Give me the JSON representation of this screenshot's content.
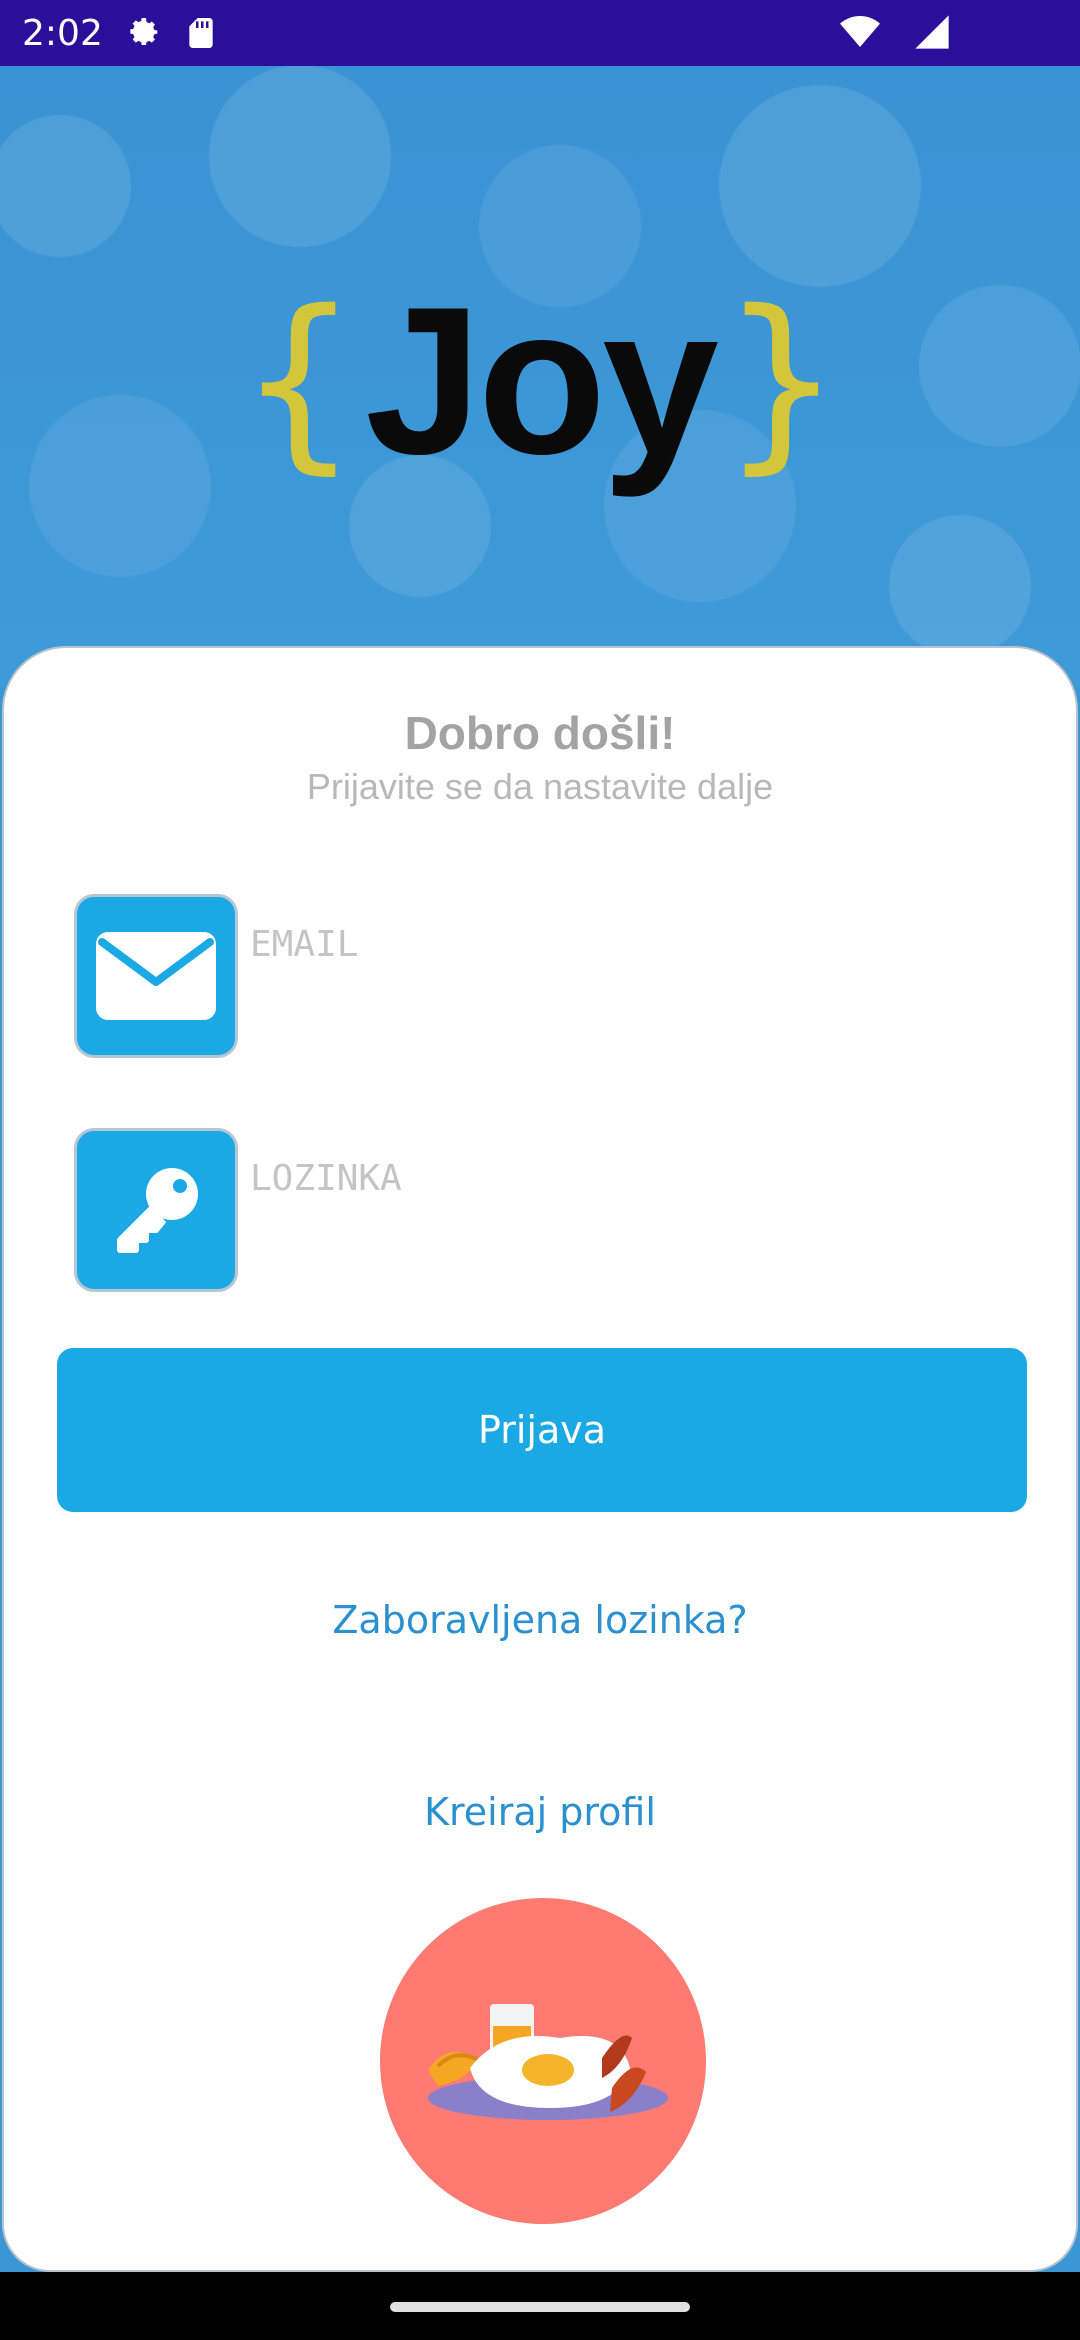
{
  "status_bar": {
    "time": "2:02",
    "icons": [
      "settings-icon",
      "sd-card-icon",
      "wifi-icon",
      "cell-signal-icon"
    ]
  },
  "app": {
    "logo_brace_left": "{",
    "logo_word": "Joy",
    "logo_brace_right": "}"
  },
  "login": {
    "title": "Dobro došli!",
    "subtitle": "Prijavite se da nastavite dalje",
    "email": {
      "placeholder": "EMAIL",
      "value": "",
      "icon": "mail-icon"
    },
    "password": {
      "placeholder": "LOZINKA",
      "value": "",
      "icon": "key-icon"
    },
    "submit_label": "Prijava",
    "forgot_password_label": "Zaboravljena lozinka?",
    "create_profile_label": "Kreiraj profil"
  },
  "colors": {
    "status_bar": "#2b0f9a",
    "hero_blue": "#3b96d6",
    "accent": "#1aa9e4",
    "link": "#2a90d0",
    "logo_brace": "#d4c63a",
    "food_circle": "#ff7a70"
  }
}
